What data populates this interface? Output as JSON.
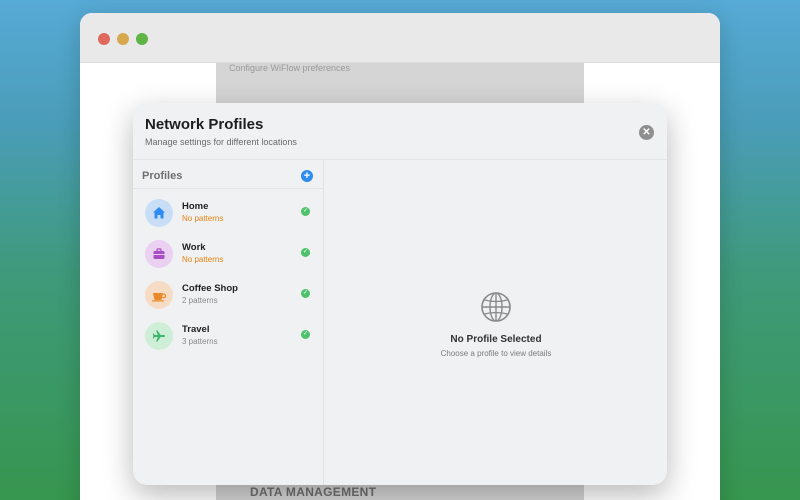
{
  "background_window": {
    "subtitle": "Configure WiFlow preferences",
    "section_label": "DATA MANAGEMENT"
  },
  "modal": {
    "title": "Network Profiles",
    "subtitle": "Manage settings for different locations",
    "close_icon": "close-icon"
  },
  "sidebar": {
    "title": "Profiles",
    "add_icon": "plus-icon",
    "profiles": [
      {
        "name": "Home",
        "desc": "No patterns",
        "icon": "house-icon",
        "color": "#2f8cf0",
        "bg": "#c8def6",
        "status": "warn"
      },
      {
        "name": "Work",
        "desc": "No patterns",
        "icon": "briefcase-icon",
        "color": "#a94ec4",
        "bg": "#ead0f1",
        "status": "warn"
      },
      {
        "name": "Coffee Shop",
        "desc": "2 patterns",
        "icon": "cup-icon",
        "color": "#e98a2a",
        "bg": "#f6dcc4",
        "status": "ok"
      },
      {
        "name": "Travel",
        "desc": "3 patterns",
        "icon": "airplane-icon",
        "color": "#3fb66a",
        "bg": "#cfeed8",
        "status": "ok"
      }
    ]
  },
  "detail": {
    "icon": "globe-icon",
    "empty_title": "No Profile Selected",
    "empty_subtitle": "Choose a profile to view details"
  }
}
